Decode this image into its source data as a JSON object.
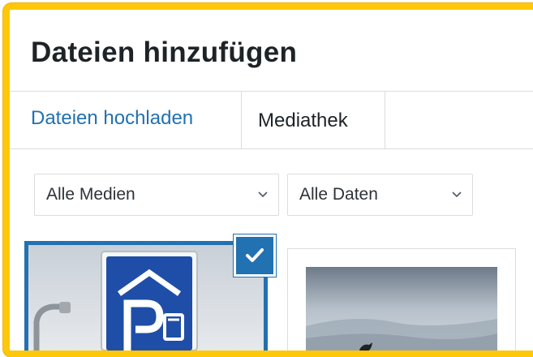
{
  "dialog": {
    "title": "Dateien hinzufügen"
  },
  "tabs": [
    {
      "label": "Dateien hochladen",
      "active": false
    },
    {
      "label": "Mediathek",
      "active": true
    }
  ],
  "filters": {
    "media_type": {
      "selected": "Alle Medien"
    },
    "dates": {
      "selected": "Alle Daten"
    }
  },
  "attachments": [
    {
      "selected": true,
      "icon": "check-icon",
      "depicts": "parking-sign"
    },
    {
      "selected": false,
      "depicts": "bird-landscape"
    }
  ],
  "colors": {
    "accent": "#2271b1",
    "highlight_border": "#fdc80a",
    "title": "#1d2327"
  }
}
